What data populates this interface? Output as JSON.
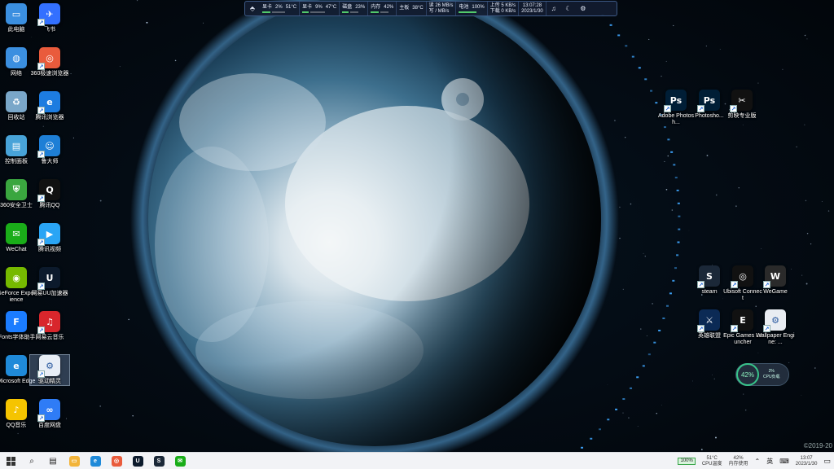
{
  "desktop": {
    "left_column_1": [
      {
        "label": "此电脑",
        "icon": "pc-icon",
        "color": "#3b8fe0"
      },
      {
        "label": "网络",
        "icon": "network-icon",
        "color": "#3b8fe0"
      },
      {
        "label": "回收站",
        "icon": "recycle-bin-icon",
        "color": "#7aa7c9"
      },
      {
        "label": "控制面板",
        "icon": "control-panel-icon",
        "color": "#48a3d8"
      },
      {
        "label": "360安全卫士",
        "icon": "360-security-icon",
        "color": "#3aa63f"
      },
      {
        "label": "WeChat",
        "icon": "wechat-icon",
        "color": "#1aad19"
      },
      {
        "label": "GeForce Experience",
        "icon": "nvidia-icon",
        "color": "#76b900"
      },
      {
        "label": "iFonts字体助手",
        "icon": "ifonts-icon",
        "color": "#1b7cff"
      },
      {
        "label": "Microsoft Edge",
        "icon": "edge-icon",
        "color": "#1f8ad9"
      },
      {
        "label": "QQ音乐",
        "icon": "qq-music-icon",
        "color": "#f5c400"
      }
    ],
    "left_column_2": [
      {
        "label": "飞书",
        "icon": "feishu-icon",
        "color": "#3370ff"
      },
      {
        "label": "360极速浏览器",
        "icon": "360-browser-icon",
        "color": "#e95b3c"
      },
      {
        "label": "腾讯浏览器",
        "icon": "browser-icon",
        "color": "#1d7ce0"
      },
      {
        "label": "鲁大师",
        "icon": "ludashi-icon",
        "color": "#1e7fd6"
      },
      {
        "label": "腾讯QQ",
        "icon": "qq-icon",
        "color": "#111111"
      },
      {
        "label": "腾讯视频",
        "icon": "tencent-video-icon",
        "color": "#2aa5f5"
      },
      {
        "label": "网易UU加速器",
        "icon": "uu-accelerator-icon",
        "color": "#0c1a2c"
      },
      {
        "label": "网易云音乐",
        "icon": "netease-music-icon",
        "color": "#d8262c"
      },
      {
        "label": "驱动精灵",
        "icon": "driver-icon",
        "color": "#e8eef6"
      },
      {
        "label": "百度网盘",
        "icon": "baidu-netdisk-icon",
        "color": "#2f7cf6"
      }
    ],
    "right_group_top": [
      {
        "label": "Adobe Photosh...",
        "icon": "photoshop-icon",
        "color": "#001e36"
      },
      {
        "label": "Photosho...",
        "icon": "photoshop-icon",
        "color": "#001e36"
      },
      {
        "label": "剪映专业版",
        "icon": "capcut-icon",
        "color": "#111111"
      }
    ],
    "right_group_bottom": [
      {
        "label": "steam",
        "icon": "steam-icon",
        "color": "#1b2838"
      },
      {
        "label": "Ubisoft Connect",
        "icon": "ubisoft-icon",
        "color": "#111111"
      },
      {
        "label": "WeGame",
        "icon": "wegame-icon",
        "color": "#2a2a2a"
      },
      {
        "label": "英雄联盟",
        "icon": "lol-icon",
        "color": "#0b2a55"
      },
      {
        "label": "Epic Games Launcher",
        "icon": "epic-icon",
        "color": "#111111"
      },
      {
        "label": "Wallpaper Engine: ...",
        "icon": "wallpaper-engine-icon",
        "color": "#e9edf2"
      }
    ]
  },
  "statusbar": {
    "gpu_label": "显卡",
    "gpu_usage": "2%",
    "gpu_temp": "51°C",
    "cpu_label": "显卡",
    "cpu_usage": "9%",
    "cpu_temp": "47°C",
    "disk_label": "磁盘",
    "disk_usage": "23%",
    "mem_label": "内存",
    "mem_usage": "42%",
    "board_label": "主板",
    "board_temp": "38°C",
    "disk_read": "读 26 MB/s",
    "disk_write": "写 / MB/s",
    "battery_label": "电池",
    "battery": "100%",
    "net_up": "上传 5 KB/s",
    "net_down": "下载 0 KB/s",
    "time": "13:07:28",
    "date": "2023/1/30"
  },
  "cpu_widget": {
    "percent": "42%",
    "sub_value": "2%",
    "sub_label": "CPU负载"
  },
  "copyright": "©2019-20",
  "taskbar": {
    "apps": [
      {
        "name": "file-explorer",
        "color": "#f2b43a",
        "glyph": "▭"
      },
      {
        "name": "edge",
        "color": "#1f8ad9",
        "glyph": "e"
      },
      {
        "name": "360-browser",
        "color": "#e95b3c",
        "glyph": "◎"
      },
      {
        "name": "uu-accelerator",
        "color": "#0c1a2c",
        "glyph": "U"
      },
      {
        "name": "steam",
        "color": "#1b2838",
        "glyph": "S"
      },
      {
        "name": "wechat",
        "color": "#1aad19",
        "glyph": "✉"
      }
    ],
    "tray": {
      "battery": "100%",
      "cpu_temp": "51°C",
      "cpu_temp_label": "CPU温度",
      "mem": "42%",
      "mem_label": "内存使用",
      "ime": "英",
      "time": "13:07",
      "date": "2023/1/30"
    }
  }
}
